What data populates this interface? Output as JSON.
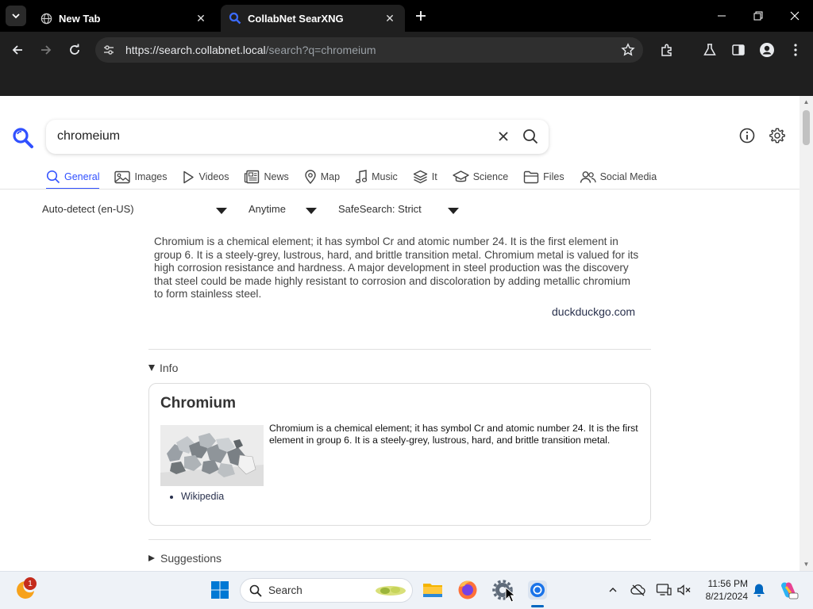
{
  "browser": {
    "tabs": [
      {
        "title": "New Tab",
        "active": false
      },
      {
        "title": "CollabNet SearXNG",
        "active": true
      }
    ],
    "url_host": "https://search.collabnet.local",
    "url_path": "/search?q=chromeium"
  },
  "search": {
    "query": "chromeium",
    "categories": [
      {
        "label": "General",
        "icon": "search-icon",
        "active": true
      },
      {
        "label": "Images",
        "icon": "image-icon"
      },
      {
        "label": "Videos",
        "icon": "play-icon"
      },
      {
        "label": "News",
        "icon": "newspaper-icon"
      },
      {
        "label": "Map",
        "icon": "map-pin-icon"
      },
      {
        "label": "Music",
        "icon": "music-note-icon"
      },
      {
        "label": "It",
        "icon": "layers-icon"
      },
      {
        "label": "Science",
        "icon": "graduation-cap-icon"
      },
      {
        "label": "Files",
        "icon": "folder-icon"
      },
      {
        "label": "Social Media",
        "icon": "people-icon"
      }
    ],
    "filters": {
      "language": "Auto-detect (en-US)",
      "time": "Anytime",
      "safesearch": "SafeSearch: Strict"
    }
  },
  "answer": {
    "text": "Chromium is a chemical element; it has symbol Cr and atomic number 24. It is the first element in group 6. It is a steely-grey, lustrous, hard, and brittle transition metal. Chromium metal is valued for its high corrosion resistance and hardness. A major development in steel production was the discovery that steel could be made highly resistant to corrosion and discoloration by adding metallic chromium to form stainless steel.",
    "source": "duckduckgo.com"
  },
  "info": {
    "summary": "Info",
    "title": "Chromium",
    "text": "Chromium is a chemical element; it has symbol Cr and atomic number 24. It is the first element in group 6. It is a steely-grey, lustrous, hard, and brittle transition metal.",
    "links": [
      "Wikipedia"
    ]
  },
  "suggestions": {
    "summary": "Suggestions"
  },
  "taskbar": {
    "search_placeholder": "Search",
    "notification_count": "1",
    "time": "11:56 PM",
    "date": "8/21/2024"
  }
}
